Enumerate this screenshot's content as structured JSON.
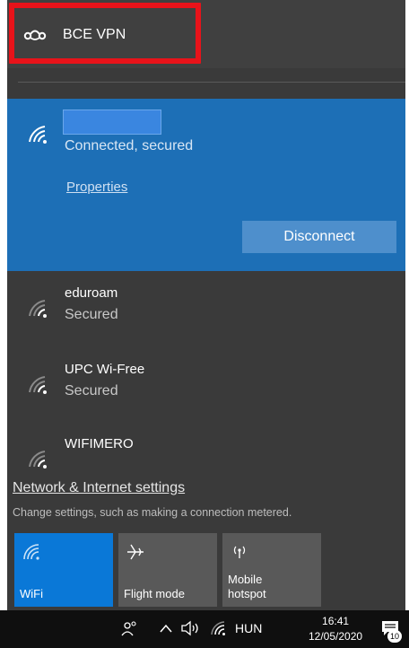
{
  "vpn": {
    "icon": "vpn-icon",
    "label": "BCE VPN"
  },
  "active_network": {
    "icon": "wifi-icon",
    "ssid": "",
    "status": "Connected, secured",
    "properties_label": "Properties",
    "disconnect_label": "Disconnect"
  },
  "networks": [
    {
      "name": "eduroam",
      "status": "Secured",
      "icon": "wifi-icon"
    },
    {
      "name": "UPC Wi-Free",
      "status": "Secured",
      "icon": "wifi-icon"
    },
    {
      "name": "WIFIMERO",
      "status": "",
      "icon": "wifi-icon"
    }
  ],
  "settings": {
    "link_label": "Network & Internet settings",
    "description": "Change settings, such as making a connection metered."
  },
  "quick_actions": [
    {
      "label": "WiFi",
      "icon": "wifi-icon",
      "active": true
    },
    {
      "label": "Flight mode",
      "icon": "airplane-icon",
      "active": false
    },
    {
      "label": "Mobile\nhotspot",
      "icon": "hotspot-icon",
      "active": false
    }
  ],
  "taskbar": {
    "people_icon": "people-icon",
    "tray_icon": "chevron-up-icon",
    "volume_icon": "speaker-icon",
    "network_icon": "wifi-icon",
    "language": "HUN",
    "time": "16:41",
    "date": "12/05/2020",
    "notifications_icon": "notification-icon",
    "notification_count": "10"
  },
  "colors": {
    "panel_bg": "#3a3a3a",
    "accent": "#1d6fb6",
    "tile_active": "#0a78d7",
    "highlight_box": "#e8131a"
  }
}
